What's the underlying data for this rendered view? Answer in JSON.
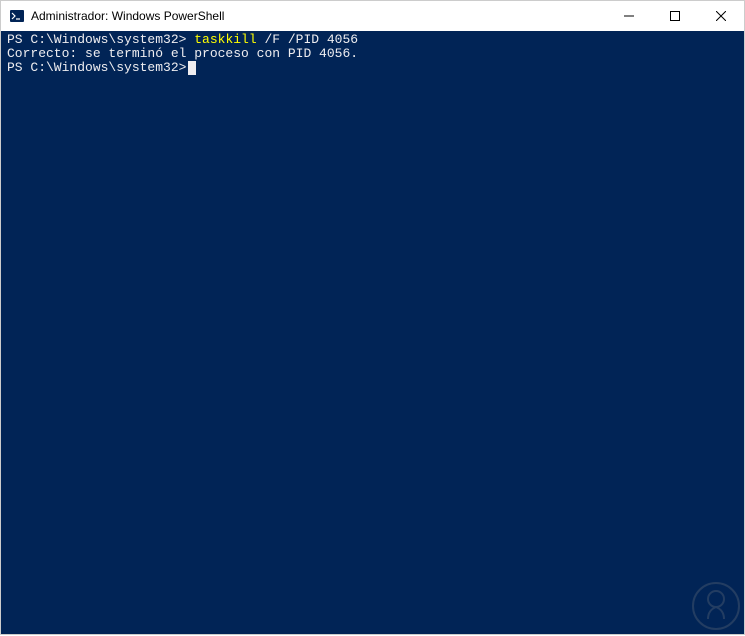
{
  "window": {
    "title": "Administrador: Windows PowerShell"
  },
  "terminal": {
    "lines": [
      {
        "prompt": "PS C:\\Windows\\system32> ",
        "command": "taskkill",
        "args": " /F /PID 4056"
      },
      {
        "output": "Correcto: se terminó el proceso con PID 4056."
      },
      {
        "prompt": "PS C:\\Windows\\system32>",
        "cursor": true
      }
    ]
  }
}
